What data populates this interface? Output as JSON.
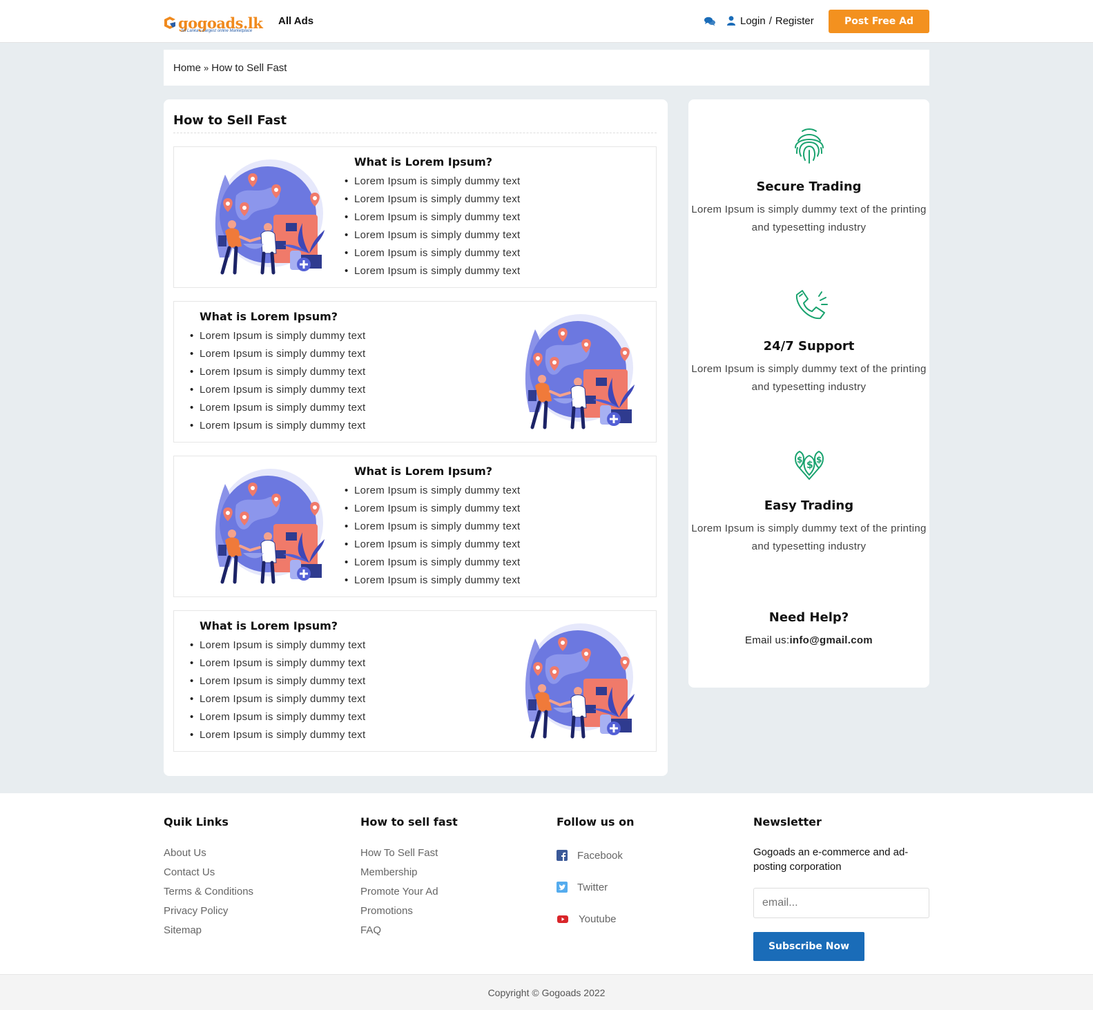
{
  "header": {
    "logo_text": "gogoads.lk",
    "logo_tagline": "Sri Lanka's Largest online Marketplace",
    "nav_all_ads": "All Ads",
    "login": "Login",
    "separator": "/",
    "register": "Register",
    "post_button": "Post Free Ad",
    "accent_color": "#f3911f"
  },
  "breadcrumb": {
    "home": "Home",
    "separator": "»",
    "current": "How to Sell Fast"
  },
  "main": {
    "title": "How to Sell Fast",
    "cards": [
      {
        "heading": "What is Lorem Ipsum?",
        "items": [
          "Lorem Ipsum is simply dummy text",
          "Lorem Ipsum is simply dummy text",
          "Lorem Ipsum is simply dummy text",
          "Lorem Ipsum is simply dummy text",
          "Lorem Ipsum is simply dummy text",
          "Lorem Ipsum is simply dummy text"
        ]
      },
      {
        "heading": "What is Lorem Ipsum?",
        "items": [
          "Lorem Ipsum is simply dummy text",
          "Lorem Ipsum is simply dummy text",
          "Lorem Ipsum is simply dummy text",
          "Lorem Ipsum is simply dummy text",
          "Lorem Ipsum is simply dummy text",
          "Lorem Ipsum is simply dummy text"
        ]
      },
      {
        "heading": "What is Lorem Ipsum?",
        "items": [
          "Lorem Ipsum is simply dummy text",
          "Lorem Ipsum is simply dummy text",
          "Lorem Ipsum is simply dummy text",
          "Lorem Ipsum is simply dummy text",
          "Lorem Ipsum is simply dummy text",
          "Lorem Ipsum is simply dummy text"
        ]
      },
      {
        "heading": "What is Lorem Ipsum?",
        "items": [
          "Lorem Ipsum is simply dummy text",
          "Lorem Ipsum is simply dummy text",
          "Lorem Ipsum is simply dummy text",
          "Lorem Ipsum is simply dummy text",
          "Lorem Ipsum is simply dummy text",
          "Lorem Ipsum is simply dummy text"
        ]
      }
    ]
  },
  "sidebar": {
    "features": [
      {
        "icon": "fingerprint-icon",
        "title": "Secure Trading",
        "text": "Lorem Ipsum is simply dummy text of the printing and typesetting industry"
      },
      {
        "icon": "phone-icon",
        "title": "24/7 Support",
        "text": "Lorem Ipsum is simply dummy text of the printing and typesetting industry"
      },
      {
        "icon": "money-pins-icon",
        "title": "Easy Trading",
        "text": "Lorem Ipsum is simply dummy text of the printing and typesetting industry"
      }
    ],
    "help_title": "Need Help?",
    "help_email_label": "Email us:",
    "help_email": "info@gmail.com",
    "icon_color": "#1aa36f"
  },
  "footer": {
    "quick_links": {
      "title": "Quik Links",
      "links": [
        "About Us",
        "Contact Us",
        "Terms & Conditions",
        "Privacy Policy",
        "Sitemap"
      ]
    },
    "sell_fast": {
      "title": "How to sell fast",
      "links": [
        "How To Sell Fast",
        "Membership",
        "Promote Your Ad",
        "Promotions",
        "FAQ"
      ]
    },
    "follow": {
      "title": "Follow us on",
      "facebook": "Facebook",
      "twitter": "Twitter",
      "youtube": "Youtube"
    },
    "newsletter": {
      "title": "Newsletter",
      "description": "Gogoads an e-commerce and ad-posting corporation",
      "placeholder": "email...",
      "button": "Subscribe Now",
      "button_color": "#1a6cb8"
    }
  },
  "copyright": "Copyright © Gogoads 2022"
}
